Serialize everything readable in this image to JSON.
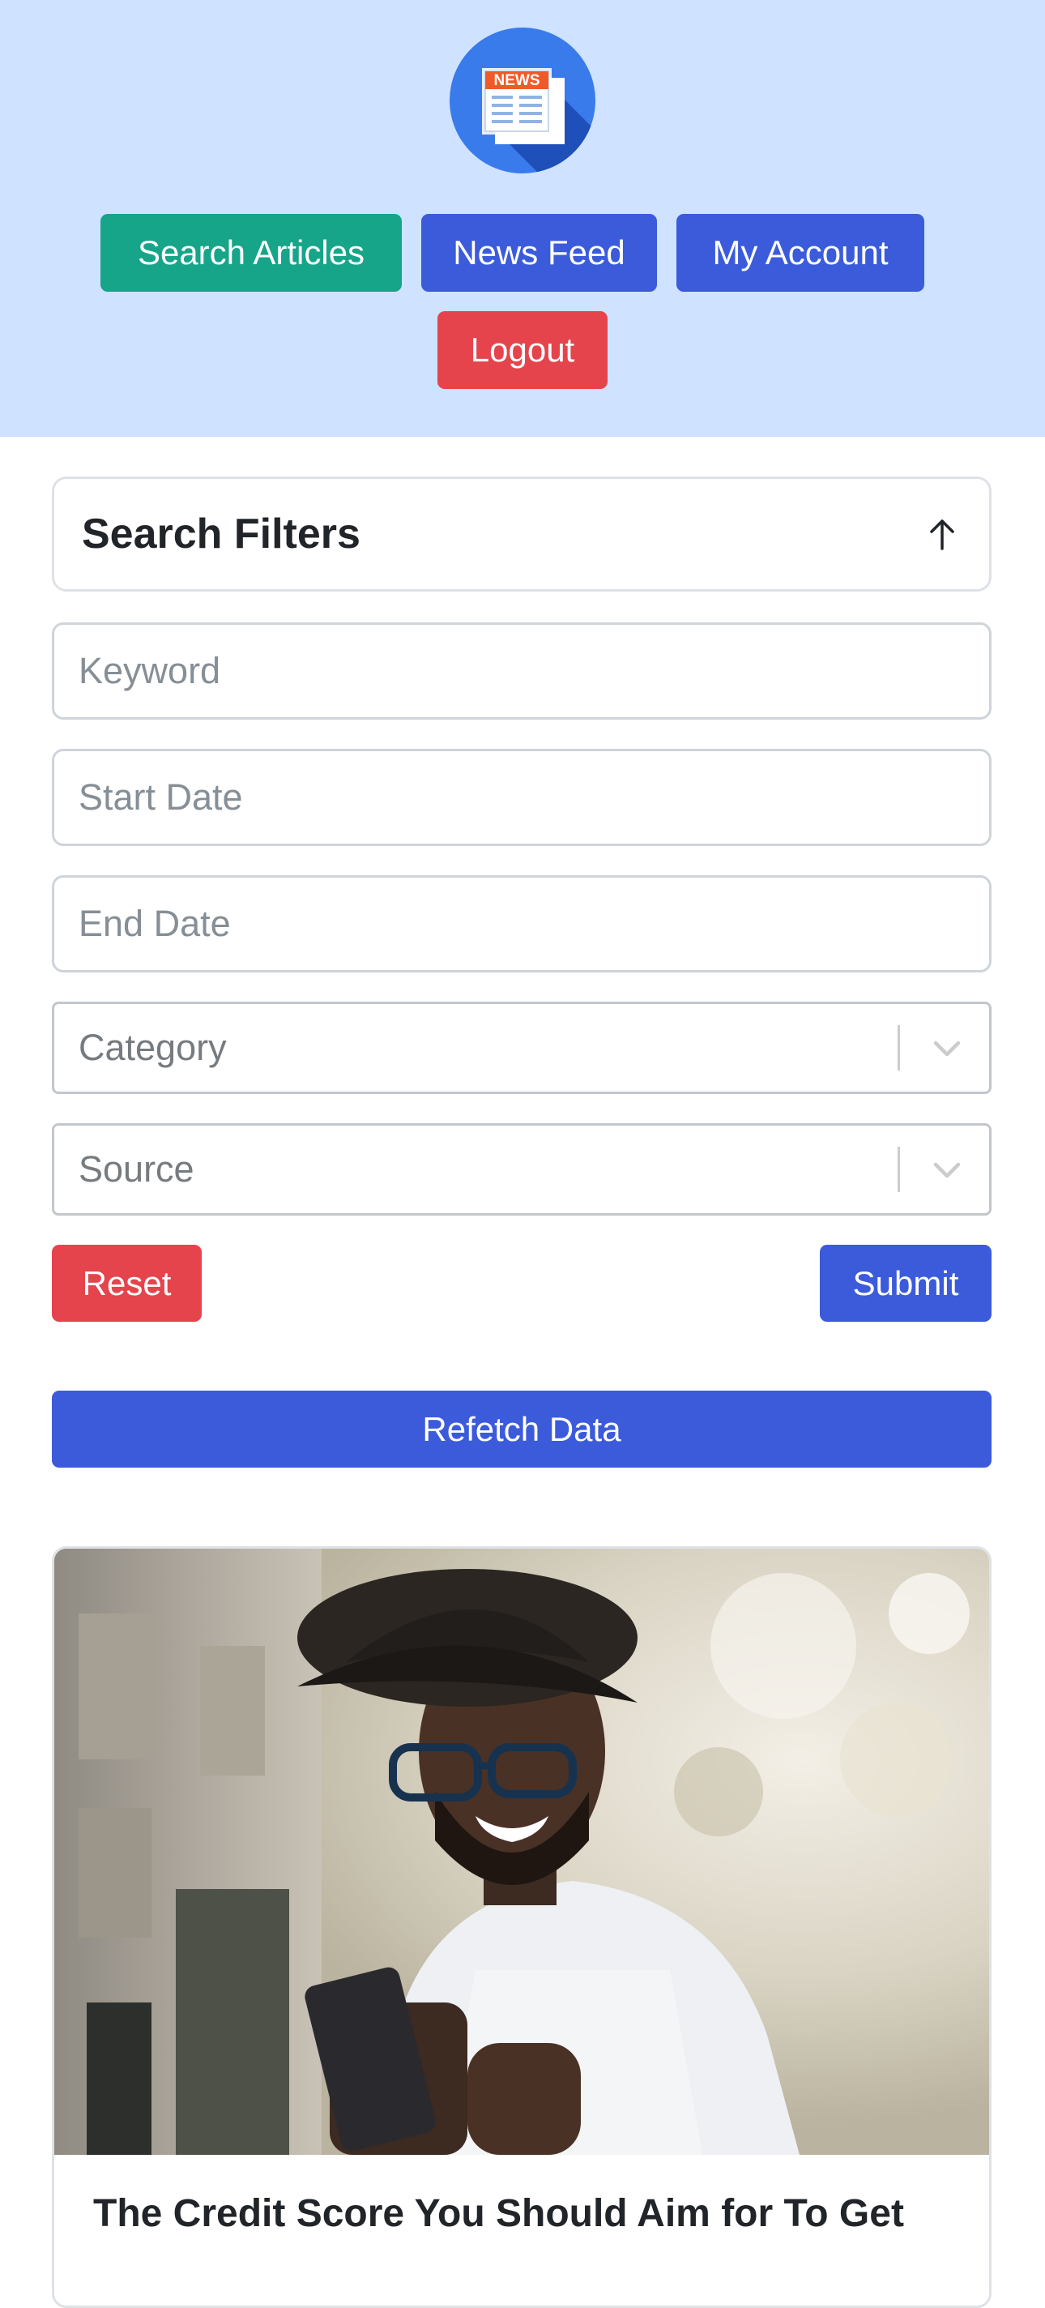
{
  "header": {
    "logo_text": "NEWS",
    "nav": {
      "search_articles": "Search Articles",
      "news_feed": "News Feed",
      "my_account": "My Account",
      "logout": "Logout"
    }
  },
  "filters": {
    "title": "Search Filters",
    "keyword_placeholder": "Keyword",
    "start_date_placeholder": "Start Date",
    "end_date_placeholder": "End Date",
    "category_placeholder": "Category",
    "source_placeholder": "Source",
    "reset_label": "Reset",
    "submit_label": "Submit"
  },
  "refetch_label": "Refetch Data",
  "articles": [
    {
      "title": "The Credit Score You Should Aim for To Get"
    }
  ],
  "colors": {
    "header_bg": "#cfe2ff",
    "primary": "#3b5bdb",
    "success": "#17a589",
    "danger": "#e5444d"
  }
}
